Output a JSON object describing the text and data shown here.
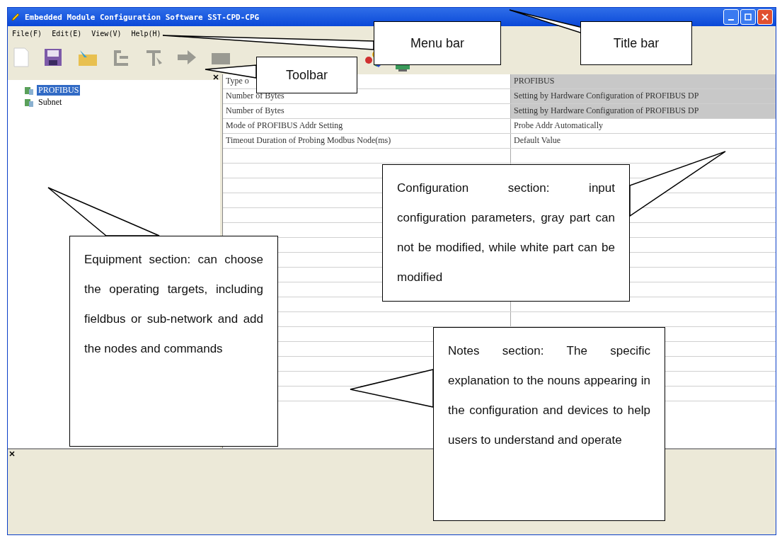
{
  "window": {
    "title": "Embedded Module Configuration Software SST-CPD-CPG"
  },
  "menu": [
    "File(F)",
    "Edit(E)",
    "View(V)",
    "Help(H)"
  ],
  "tree": [
    {
      "label": "PROFIBUS",
      "selected": true
    },
    {
      "label": "Subnet",
      "selected": false
    }
  ],
  "table": {
    "rows": [
      {
        "name": "Type o",
        "value": "PROFIBUS",
        "editable": false
      },
      {
        "name": "Number of Bytes",
        "value": "Setting by Hardware Configuration of PROFIBUS DP",
        "editable": false
      },
      {
        "name": "Number of Bytes",
        "value": "Setting by Hardware Configuration of PROFIBUS DP",
        "editable": false
      },
      {
        "name": "Mode of PROFIBUS Addr Setting",
        "value": "Probe Addr Automatically",
        "editable": true
      },
      {
        "name": "Timeout Duration of Probing Modbus Node(ms)",
        "value": "Default Value",
        "editable": true
      }
    ]
  },
  "callouts": [
    "Menu bar",
    "Title bar",
    "Toolbar",
    "Configuration section: input configuration parameters, gray part can not be modified, while white part can be modified",
    "Equipment section: can choose the operating targets, including fieldbus or sub-network and add the nodes and commands",
    "Notes section: The specific explanation to the nouns appearing in the configuration and devices to help users to understand and operate"
  ]
}
